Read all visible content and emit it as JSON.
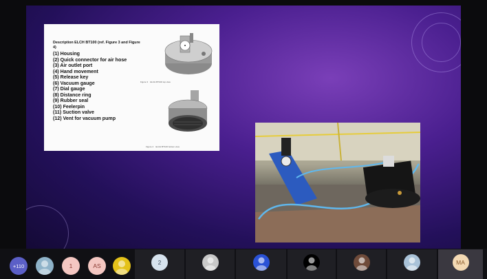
{
  "document": {
    "title": "Description ELCH BT100 (ref. Figure 3 and Figure 4)",
    "items": [
      "(1) Housing",
      "(2) Quick connector for air hose",
      "(3) Air outlet port",
      "(4) Hand movement",
      "(5) Release key",
      "(6) Vacuum gauge",
      "(7) Dial gauge",
      "(8) Distance ring",
      "(9) Rubber seal",
      "(10) Feelerpin",
      "(11) Suction valve",
      "(12) Vent for vacuum pump"
    ]
  },
  "participants": {
    "overflow_count": "+110",
    "left_avatars": [
      {
        "kind": "photo",
        "color": "#8fb3c9"
      },
      {
        "kind": "initials",
        "text": "1",
        "color": "#f4c7c2",
        "text_color": "#8a3b33"
      },
      {
        "kind": "initials",
        "text": "AS",
        "color": "#f4c7c2",
        "text_color": "#8a3b33"
      },
      {
        "kind": "photo",
        "color": "#e4c21a"
      }
    ],
    "tiles": [
      {
        "avatar_text": "2",
        "avatar_color": "#d7e3ee",
        "avatar_text_color": "#3b4b5c",
        "active": false
      },
      {
        "avatar_text": "",
        "avatar_color": "#c9c9c9",
        "active": false
      },
      {
        "avatar_text": "",
        "avatar_color": "#2a52d6",
        "active": false
      },
      {
        "avatar_text": "",
        "avatar_color": "#000000",
        "active": false
      },
      {
        "avatar_text": "",
        "avatar_color": "#6f4b3a",
        "active": false
      },
      {
        "avatar_text": "",
        "avatar_color": "#a9c2d8",
        "active": false
      },
      {
        "avatar_text": "MA",
        "avatar_color": "#f3d9b3",
        "avatar_text_color": "#8a5a2b",
        "active": true
      }
    ]
  },
  "colors": {
    "stage_purple": "#4a1f8f",
    "bar_bg": "#101014",
    "tile_bg": "#1f1f24",
    "active_tile_bg": "#3a3840",
    "photo_blue_stand": "#2c5bbf",
    "hose_blue": "#5fb8ee"
  }
}
